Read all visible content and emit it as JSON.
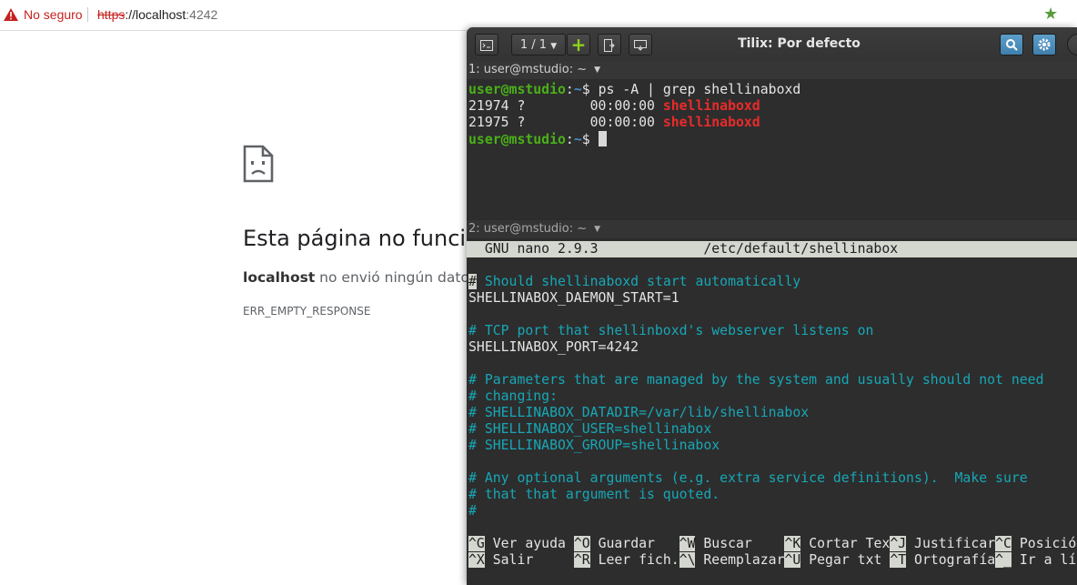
{
  "browser": {
    "security_label": "No seguro",
    "url_scheme": "https",
    "url_host": "://localhost",
    "url_port": ":4242",
    "error_title": "Esta página no funci",
    "error_host": "localhost",
    "error_desc": " no envió ningún dato.",
    "error_code": "ERR_EMPTY_RESPONSE"
  },
  "tilix": {
    "session_label": "1 / 1",
    "title": "Tilix: Por defecto",
    "pane1_title": "1: user@mstudio: ~",
    "pane2_title": "2: user@mstudio: ~",
    "colors": {
      "prompt_user": "#4ab119",
      "prompt_path": "#4d8bc7",
      "match": "#e82b2b",
      "comment": "#17a7b6"
    }
  },
  "terminal1": {
    "prompt_user": "user@mstudio",
    "prompt_sep": ":",
    "prompt_path": "~",
    "prompt_end": "$ ",
    "command": "ps -A | grep shellinaboxd",
    "rows": [
      {
        "pre": "21974 ?        00:00:00 ",
        "match": "shellinaboxd"
      },
      {
        "pre": "21975 ?        00:00:00 ",
        "match": "shellinaboxd"
      }
    ]
  },
  "nano": {
    "header": "  GNU nano 2.9.3             /etc/default/shellinabox",
    "lines": [
      {
        "text": "",
        "type": "plain"
      },
      {
        "text": "# Should shellinaboxd start automatically",
        "type": "comment-cursor"
      },
      {
        "text": "SHELLINABOX_DAEMON_START=1",
        "type": "plain"
      },
      {
        "text": "",
        "type": "plain"
      },
      {
        "text": "# TCP port that shellinboxd's webserver listens on",
        "type": "comment"
      },
      {
        "text": "SHELLINABOX_PORT=4242",
        "type": "plain"
      },
      {
        "text": "",
        "type": "plain"
      },
      {
        "text": "# Parameters that are managed by the system and usually should not need",
        "type": "comment"
      },
      {
        "text": "# changing:",
        "type": "comment"
      },
      {
        "text": "# SHELLINABOX_DATADIR=/var/lib/shellinabox",
        "type": "comment"
      },
      {
        "text": "# SHELLINABOX_USER=shellinabox",
        "type": "comment"
      },
      {
        "text": "# SHELLINABOX_GROUP=shellinabox",
        "type": "comment"
      },
      {
        "text": "",
        "type": "plain"
      },
      {
        "text": "# Any optional arguments (e.g. extra service definitions).  Make sure",
        "type": "comment"
      },
      {
        "text": "# that that argument is quoted.",
        "type": "comment"
      },
      {
        "text": "#",
        "type": "comment"
      }
    ],
    "shortcuts_row1": [
      {
        "key": "^G",
        "label": " Ver ayuda "
      },
      {
        "key": "^O",
        "label": " Guardar   "
      },
      {
        "key": "^W",
        "label": " Buscar    "
      },
      {
        "key": "^K",
        "label": " Cortar Tex"
      },
      {
        "key": "^J",
        "label": " Justificar"
      },
      {
        "key": "^C",
        "label": " Posició"
      }
    ],
    "shortcuts_row2": [
      {
        "key": "^X",
        "label": " Salir     "
      },
      {
        "key": "^R",
        "label": " Leer fich."
      },
      {
        "key": "^\\",
        "label": " Reemplazar"
      },
      {
        "key": "^U",
        "label": " Pegar txt "
      },
      {
        "key": "^T",
        "label": " Ortografía"
      },
      {
        "key": "^_",
        "label": " Ir a lí"
      }
    ]
  }
}
